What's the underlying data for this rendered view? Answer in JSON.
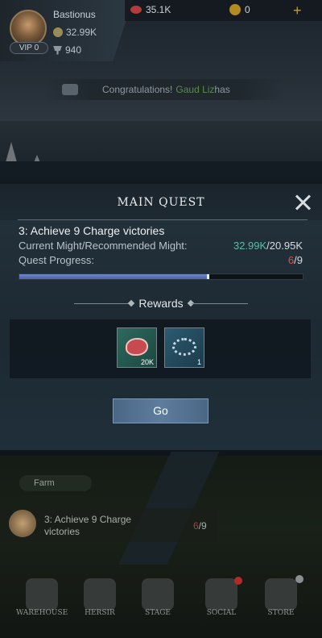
{
  "player": {
    "name": "Bastionus",
    "vip": "VIP 0",
    "might": "32.99K",
    "trophies": "940"
  },
  "resources": {
    "meat": "35.1K",
    "gold": "0",
    "add_label": "+"
  },
  "announcement": {
    "prefix": "Congratulations!",
    "player": "Gaud Liz",
    "suffix": "has"
  },
  "modal": {
    "title": "MAIN QUEST",
    "quest_name": "3: Achieve 9 Charge victories",
    "might_label": "Current Might/Recommended Might:",
    "might_current": "32.99K",
    "might_recommended": "/20.95K",
    "progress_label": "Quest Progress:",
    "progress_current": "6",
    "progress_total": "/9",
    "progress_fraction": 0.67,
    "rewards_title": "Rewards",
    "rewards": [
      {
        "name": "meat",
        "count": "20K"
      },
      {
        "name": "chain",
        "count": "1"
      }
    ],
    "go_label": "Go"
  },
  "map": {
    "farm_label": "Farm"
  },
  "quest_tracker": {
    "text": "3: Achieve 9 Charge victories",
    "progress_current": "6",
    "progress_total": "/9"
  },
  "nav": [
    {
      "label": "WAREHOUSE"
    },
    {
      "label": "HERSIR"
    },
    {
      "label": "STAGE"
    },
    {
      "label": "SOCIAL"
    },
    {
      "label": "STORE"
    }
  ],
  "colors": {
    "might_green": "#5bbfa5",
    "progress_red": "#e04c4c",
    "button_blue": "#5e7d9e"
  }
}
